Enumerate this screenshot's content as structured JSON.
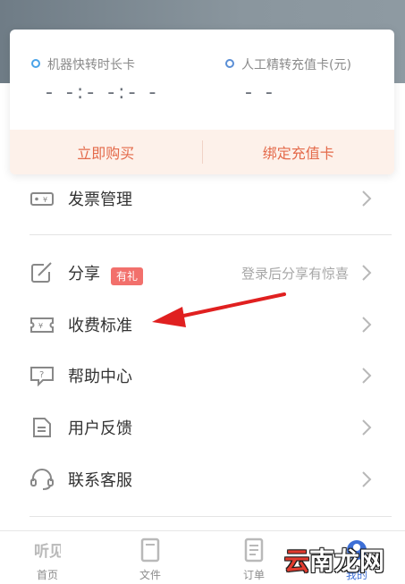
{
  "card": {
    "stat_left": {
      "label": "机器快转时长卡",
      "value": "- -:- -:- -"
    },
    "stat_right": {
      "label": "人工精转充值卡(元)",
      "value": "- -"
    },
    "buy_label": "立即购买",
    "bind_label": "绑定充值卡"
  },
  "menu": {
    "invoice": "发票管理",
    "share": "分享",
    "share_badge": "有礼",
    "share_hint": "登录后分享有惊喜",
    "pricing": "收费标准",
    "help": "帮助中心",
    "feedback": "用户反馈",
    "support": "联系客服"
  },
  "tabbar": {
    "home": "首页",
    "files": "文件",
    "orders": "订单",
    "mine": "我的"
  },
  "watermark": {
    "part1": "云",
    "part2": "南龙网"
  },
  "colors": {
    "accent_orange": "#e46a4a",
    "badge_red": "#f2706c",
    "active_blue": "#3d6fd6",
    "annotation_arrow": "#e02020"
  }
}
